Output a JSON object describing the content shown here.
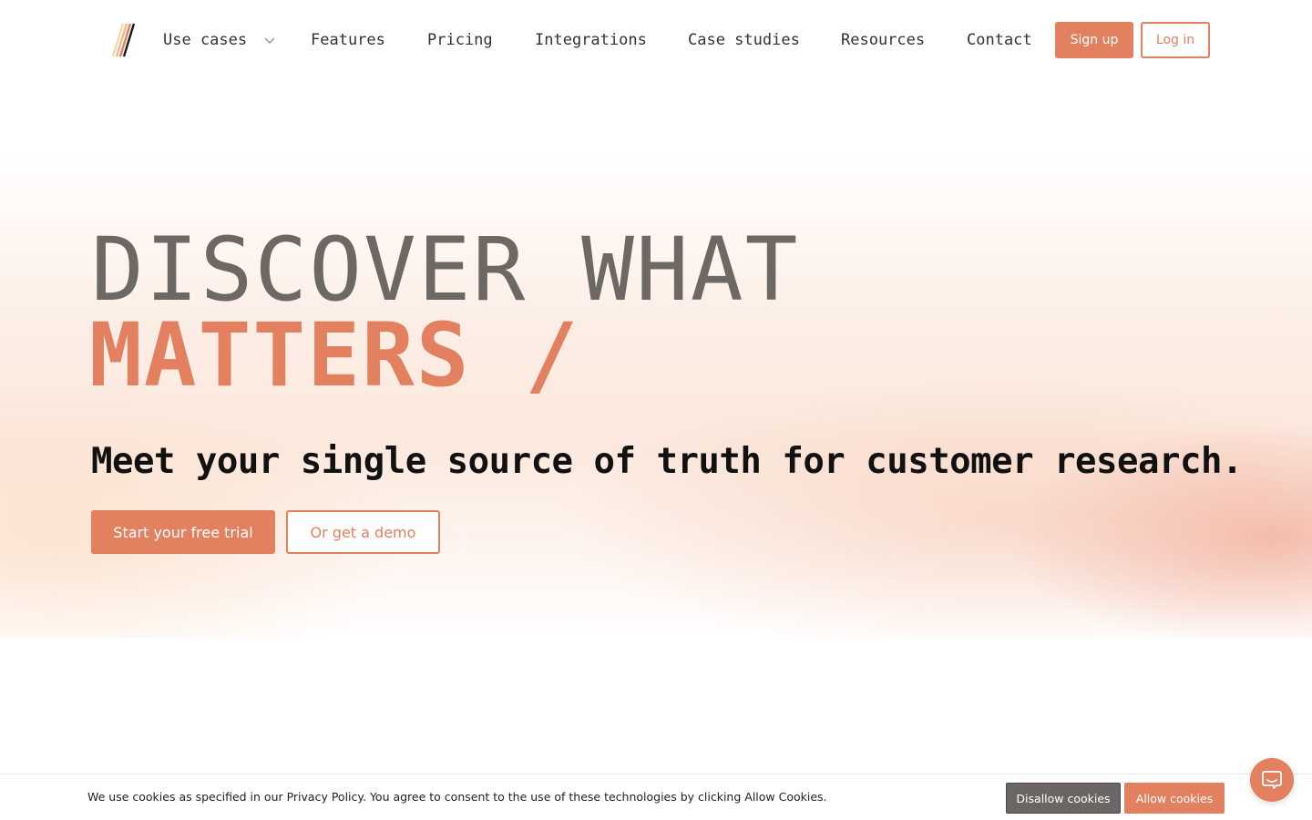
{
  "nav": {
    "items": [
      {
        "label": "Use cases",
        "has_dropdown": true
      },
      {
        "label": "Features"
      },
      {
        "label": "Pricing"
      },
      {
        "label": "Integrations"
      },
      {
        "label": "Case studies"
      },
      {
        "label": "Resources"
      },
      {
        "label": "Contact"
      }
    ],
    "signup_label": "Sign up",
    "login_label": "Log in"
  },
  "hero": {
    "headline_line1": "DISCOVER WHAT",
    "headline_line2": "MATTERS /",
    "subheadline": "Meet your single source of truth for customer research.",
    "primary_cta": "Start your free trial",
    "secondary_cta": "Or get a demo"
  },
  "cookie_banner": {
    "text": "We use cookies as specified in our Privacy Policy. You agree to consent to the use of these technologies by clicking Allow Cookies.",
    "disallow_label": "Disallow cookies",
    "allow_label": "Allow cookies"
  },
  "colors": {
    "accent": "#e2805f",
    "headline_gray": "#6e6864",
    "disallow_bg": "#6b6563"
  },
  "icons": {
    "logo": "brand-slash-logo",
    "dropdown": "chevron-down-icon",
    "chat": "chat-bubble-icon"
  }
}
